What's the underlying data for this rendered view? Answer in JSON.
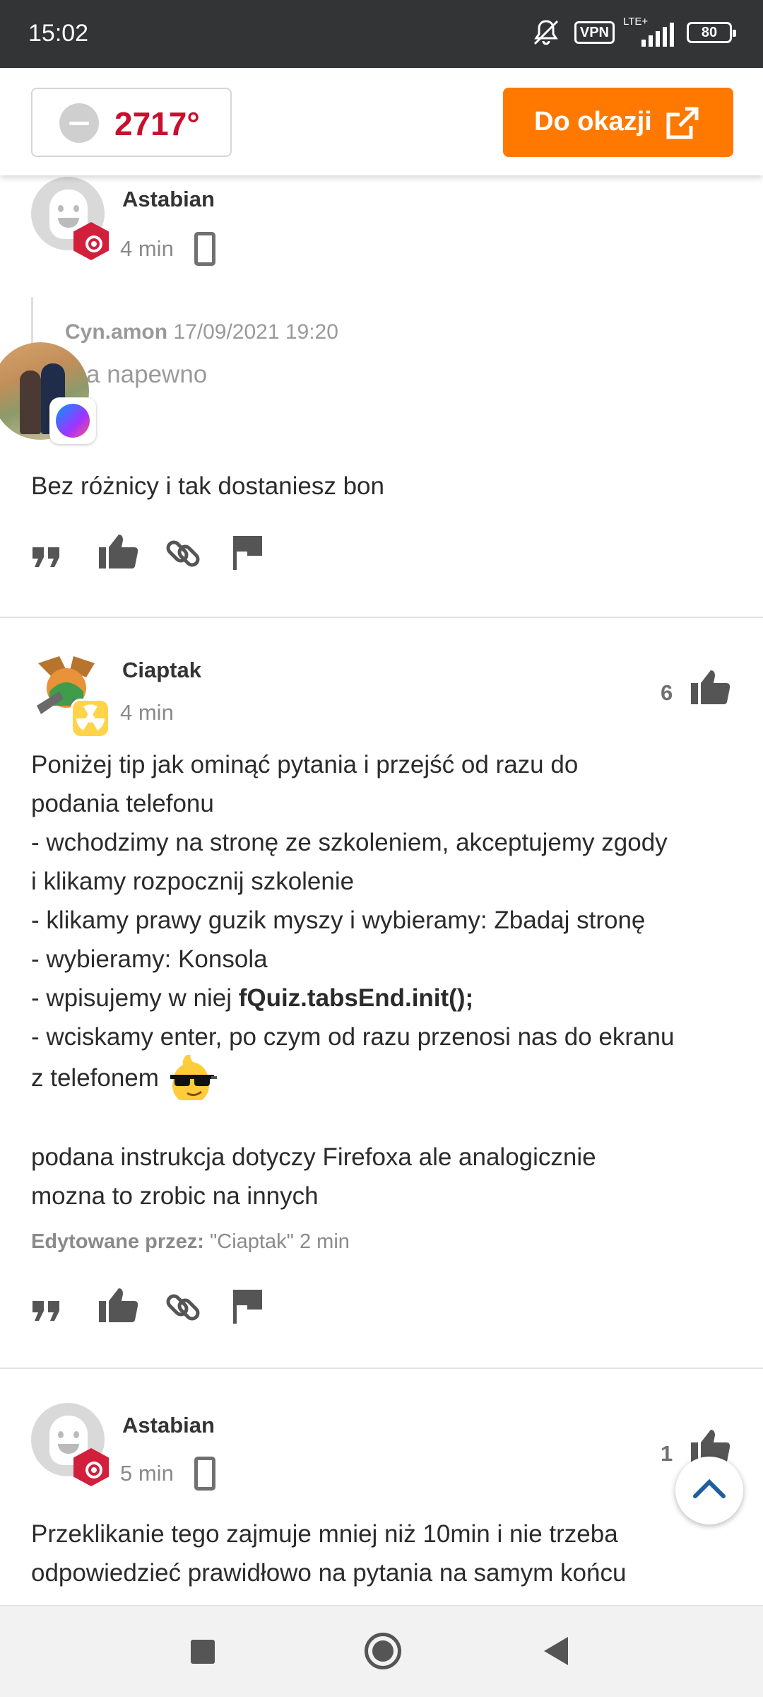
{
  "status_bar": {
    "time": "15:02",
    "vpn_label": "VPN",
    "network_label": "LTE+",
    "battery": "80"
  },
  "header": {
    "temperature": "2717°",
    "deal_button_label": "Do okazji",
    "accent_color": "#ff7900",
    "temperature_color": "#c8102e"
  },
  "comments": [
    {
      "author": "Astabian",
      "time": "4 min",
      "device_icon": "phone-icon",
      "quote": {
        "author": "Cyn.amon",
        "date": "17/09/2021 19:20",
        "text": "a napewno"
      },
      "text": "Bez różnicy i tak dostaniesz bon"
    },
    {
      "author": "Ciaptak",
      "time": "4 min",
      "likes": "6",
      "lines": [
        "Poniżej tip jak ominąć pytania i przejść od razu do",
        "podania telefonu",
        "- wchodzimy na stronę ze szkoleniem, akceptujemy zgody",
        "i klikamy rozpocznij szkolenie",
        "- klikamy prawy guzik myszy i wybieramy: Zbadaj stronę",
        "- wybieramy: Konsola",
        "- wpisujemy w niej ",
        "fQuiz.tabsEnd.init();",
        "- wciskamy enter, po czym od razu przenosi nas do ekranu",
        "z telefonem",
        "podana instrukcja dotyczy Firefoxa ale analogicznie",
        "mozna to zrobic na innych"
      ],
      "edited_label": "Edytowane przez:",
      "edited_by": "\"Ciaptak\" 2 min"
    },
    {
      "author": "Astabian",
      "time": "5 min",
      "likes": "1",
      "device_icon": "phone-icon",
      "lines": [
        "Przeklikanie tego zajmuje mniej niż 10min i nie trzeba",
        "odpowiedzieć prawidłowo na pytania na samym końcu"
      ]
    }
  ],
  "action_icons": [
    "quote-icon",
    "thumbs-up-icon",
    "link-icon",
    "flag-icon"
  ]
}
